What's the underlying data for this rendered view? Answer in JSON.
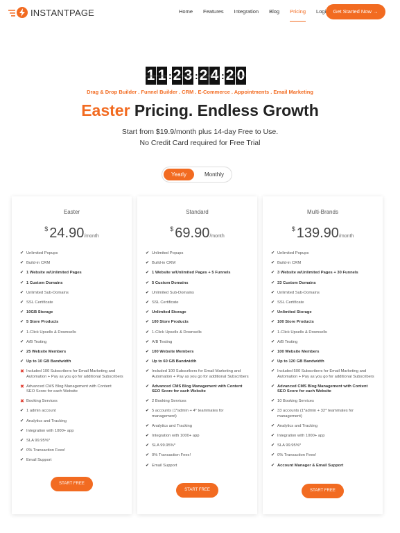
{
  "header": {
    "logo_text": "INSTANTPAGE",
    "nav": [
      "Home",
      "Features",
      "Integration",
      "Blog",
      "Pricing",
      "Login"
    ],
    "active_nav": "Pricing",
    "cta_label": "Get Started Now →",
    "accent_color": "#f26b21"
  },
  "countdown": {
    "digits": [
      "1",
      "1",
      "2",
      "3",
      "2",
      "4",
      "2",
      "0"
    ]
  },
  "tagline": "Drag & Drop Builder . Funnel Builder . CRM . E-Commerce . Appointments . Email Marketing",
  "headline": {
    "accent": "Easter",
    "rest": " Pricing. Endless Growth"
  },
  "subtitle": [
    "Start from $19.9/month plus 14-day Free to Use.",
    "No Credit Card required for Free Trial"
  ],
  "billing_toggle": {
    "yearly": "Yearly",
    "monthly": "Monthly",
    "selected": "Yearly"
  },
  "plans": [
    {
      "name": "Easter",
      "currency": "$",
      "price": "24.90",
      "period": "/month",
      "button": "START FREE",
      "features": [
        {
          "text": "Unlimited Popups"
        },
        {
          "text": "Build-in CRM"
        },
        {
          "text": "1 Website w/Unlimited Pages",
          "bold": true
        },
        {
          "text": "1 Custom Domains",
          "bold": true
        },
        {
          "text": "Unlimited Sub-Domains"
        },
        {
          "text": "SSL Certificate"
        },
        {
          "text": "10GB Storage",
          "bold": true
        },
        {
          "text": "5 Store Products",
          "bold": true
        },
        {
          "text": "1-Click Upsells & Downsells"
        },
        {
          "text": "A/B Testing"
        },
        {
          "text": "25 Website Members",
          "bold": true
        },
        {
          "text": "Up to 10 GB Bandwidth",
          "bold": true
        },
        {
          "text": "Included 100 Subscribers for Email Marketing and\nAutomation + Pay as you go for additional Subscribers",
          "x": true
        },
        {
          "text": "Advanced CMS Blog Management with Content\nSEO Score for each Website",
          "x": true
        },
        {
          "text": "Booking Services",
          "x": true
        },
        {
          "text": "1 admin account"
        },
        {
          "text": "Analytics and Tracking"
        },
        {
          "text": "Integration with 1000+ app"
        },
        {
          "text": "SLA 99.95%*"
        },
        {
          "text": "0% Transaction Fees!"
        },
        {
          "text": "Email Support"
        }
      ]
    },
    {
      "name": "Standard",
      "currency": "$",
      "price": "69.90",
      "period": "/month",
      "button": "START FREE",
      "features": [
        {
          "text": "Unlimited Popups"
        },
        {
          "text": "Build-in CRM"
        },
        {
          "text": "1 Website w/Unlimited Pages + 5 Funnels",
          "bold": true
        },
        {
          "text": "5 Custom Domains",
          "bold": true
        },
        {
          "text": "Unlimited Sub-Domains"
        },
        {
          "text": "SSL Certificate"
        },
        {
          "text": "Unlimited Storage",
          "bold": true
        },
        {
          "text": "100 Store Products",
          "bold": true
        },
        {
          "text": "1-Click Upsells & Downsells"
        },
        {
          "text": "A/B Testing"
        },
        {
          "text": "100 Website Members",
          "bold": true
        },
        {
          "text": "Up to 60 GB Bandwidth",
          "bold": true
        },
        {
          "text": "Included 100 Subscribers for Email Marketing and\nAutomation + Pay as you go for additional Subscribers"
        },
        {
          "text": "Advanced CMS Blog Management with Content\nSEO Score for each Website",
          "bold": true
        },
        {
          "text": "2 Booking Services"
        },
        {
          "text": "5 accounts (1*admin + 4* teammates for\nmanagement)"
        },
        {
          "text": "Analytics and Tracking"
        },
        {
          "text": "Integration with 1000+ app"
        },
        {
          "text": "SLA 99.95%*"
        },
        {
          "text": "0% Transaction Fees!"
        },
        {
          "text": "Email Support"
        }
      ]
    },
    {
      "name": "Multi-Brands",
      "currency": "$",
      "price": "139.90",
      "period": "/month",
      "button": "START FREE",
      "features": [
        {
          "text": "Unlimited Popups"
        },
        {
          "text": "Build-in CRM"
        },
        {
          "text": "3 Website w/Unlimited Pages + 30 Funnels",
          "bold": true
        },
        {
          "text": "33 Custom Domains",
          "bold": true
        },
        {
          "text": "Unlimited Sub-Domains"
        },
        {
          "text": "SSL Certificate"
        },
        {
          "text": "Unlimited Storage",
          "bold": true
        },
        {
          "text": "100 Store Products",
          "bold": true
        },
        {
          "text": "1-Click Upsells & Downsells"
        },
        {
          "text": "A/B Testing"
        },
        {
          "text": "100 Website Members",
          "bold": true
        },
        {
          "text": "Up to 120 GB Bandwidth",
          "bold": true
        },
        {
          "text": "Included 500 Subscribers for Email Marketing and\nAutomation + Pay as you go for additional Subscribers"
        },
        {
          "text": "Advanced CMS Blog Management with Content\nSEO Score for each Website",
          "bold": true
        },
        {
          "text": "10 Booking Services"
        },
        {
          "text": "33 accounts (1*admin + 32* teammates for\nmanagement)"
        },
        {
          "text": "Analytics and Tracking"
        },
        {
          "text": "Integration with 1000+ app"
        },
        {
          "text": "SLA 99.95%*"
        },
        {
          "text": "0% Transaction Fees!"
        },
        {
          "text": "Account Manager & Email Support",
          "bold": true
        }
      ]
    }
  ]
}
